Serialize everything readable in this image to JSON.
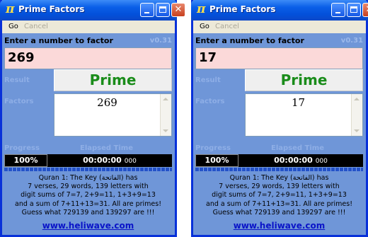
{
  "windows": [
    {
      "title": "Prime Factors",
      "title_icon": "π",
      "menu": {
        "go": "Go",
        "cancel": "Cancel"
      },
      "prompt": "Enter a number to factor",
      "version": "v0.31",
      "input_value": "269",
      "result_label": "Result",
      "result_value": "Prime",
      "factors_label": "Factors",
      "factors": [
        "269"
      ],
      "progress_label": "Progress",
      "elapsed_label": "Elapsed Time",
      "progress_percent": "100%",
      "elapsed_main": "00:00:00",
      "elapsed_ms": "000",
      "quote": [
        "Quran 1: The Key (الفاتحة) has",
        "7 verses, 29 words, 139 letters with",
        "digit sums of 7=7, 2+9=11, 1+3+9=13",
        "and a sum of 7+11+13=31. All are primes!",
        "Guess what 729139 and 139297 are !!!"
      ],
      "link": "www.heliwave.com"
    },
    {
      "title": "Prime Factors",
      "title_icon": "π",
      "menu": {
        "go": "Go",
        "cancel": "Cancel"
      },
      "prompt": "Enter a number to factor",
      "version": "v0.31",
      "input_value": "17",
      "result_label": "Result",
      "result_value": "Prime",
      "factors_label": "Factors",
      "factors": [
        "17"
      ],
      "progress_label": "Progress",
      "elapsed_label": "Elapsed Time",
      "progress_percent": "100%",
      "elapsed_main": "00:00:00",
      "elapsed_ms": "000",
      "quote": [
        "Quran 1: The Key (الفاتحة) has",
        "7 verses, 29 words, 139 letters with",
        "digit sums of 7=7, 2+9=11, 1+3+9=13",
        "and a sum of 7+11+13=31. All are primes!",
        "Guess what 729139 and 139297 are !!!"
      ],
      "link": "www.heliwave.com"
    }
  ],
  "colors": {
    "titlebar": "#0a5fe8",
    "window_bg": "#6f96d8",
    "input_bg": "#fbd9d9",
    "prime_text": "#1a8c1a",
    "link": "#0a14c8"
  },
  "icons": {
    "minimize": "minimize-icon",
    "maximize": "maximize-icon",
    "close": "close-icon"
  }
}
